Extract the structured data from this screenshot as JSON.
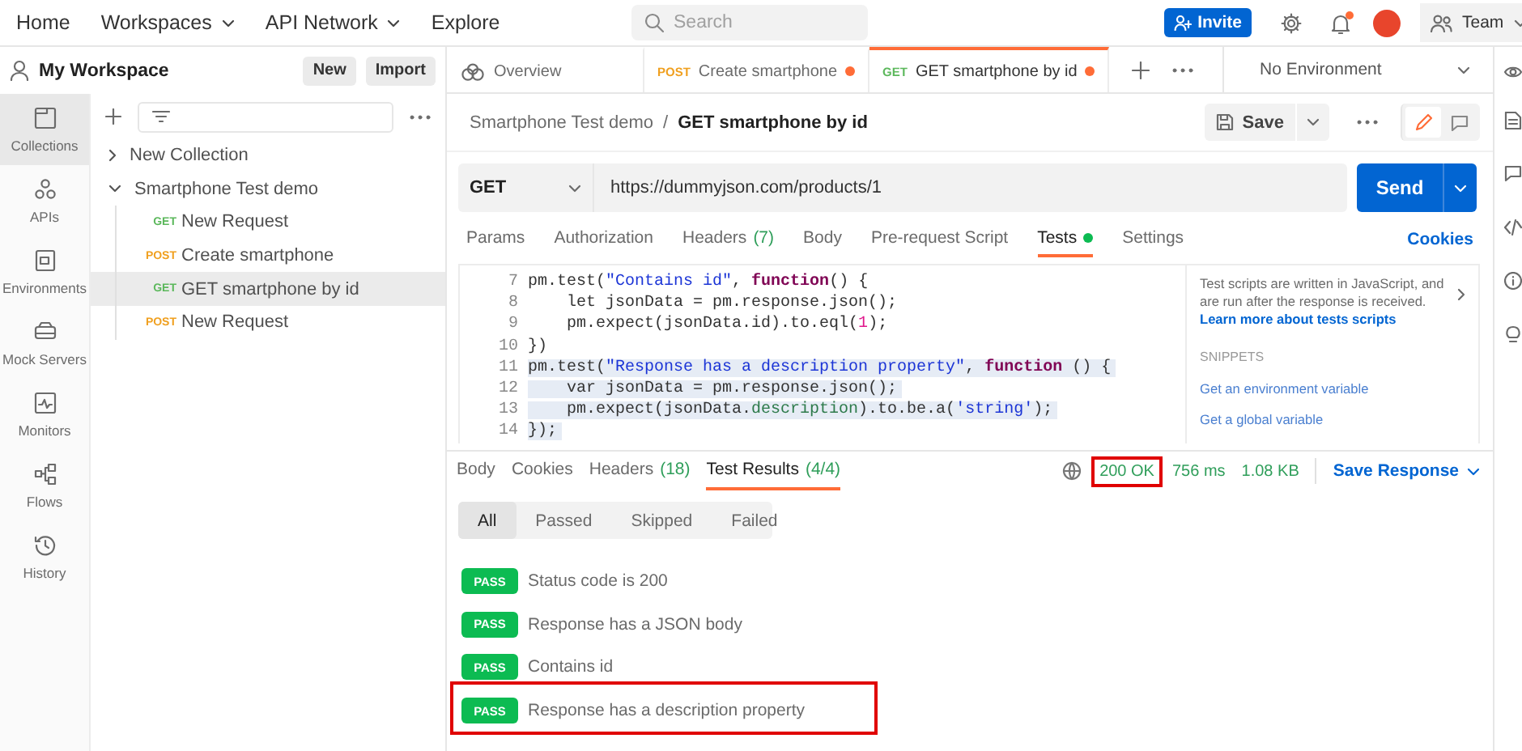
{
  "top_nav": {
    "items": [
      {
        "label": "Home",
        "dropdown": false
      },
      {
        "label": "Workspaces",
        "dropdown": true
      },
      {
        "label": "API Network",
        "dropdown": true
      },
      {
        "label": "Explore",
        "dropdown": false
      }
    ],
    "search": {
      "placeholder": "Search"
    },
    "invite_button": "Invite",
    "notification_dot": true,
    "team_button": "Team"
  },
  "workspace": {
    "title": "My Workspace",
    "buttons": [
      "New",
      "Import"
    ]
  },
  "sidebar_nav": [
    {
      "label": "Collections",
      "selected": true
    },
    {
      "label": "APIs",
      "selected": false
    },
    {
      "label": "Environments",
      "selected": false
    },
    {
      "label": "Mock Servers",
      "selected": false
    },
    {
      "label": "Monitors",
      "selected": false
    },
    {
      "label": "Flows",
      "selected": false
    },
    {
      "label": "History",
      "selected": false
    }
  ],
  "tree": [
    {
      "label": "New Collection",
      "expanded": false
    },
    {
      "label": "Smartphone Test demo",
      "expanded": true,
      "children": [
        {
          "method": "GET",
          "color": "#5cb85c",
          "label": "New Request",
          "selected": false
        },
        {
          "method": "POST",
          "color": "#f0a020",
          "label": "Create smartphone",
          "selected": false
        },
        {
          "method": "GET",
          "color": "#5cb85c",
          "label": "GET smartphone by id",
          "selected": true
        },
        {
          "method": "POST",
          "color": "#f0a020",
          "label": "New Request",
          "selected": false
        }
      ]
    }
  ],
  "tabs": [
    {
      "kind": "overview",
      "label": "Overview",
      "selected": false,
      "unsaved": false
    },
    {
      "kind": "request",
      "method": "POST",
      "color": "#f0a020",
      "label": "Create smartphone",
      "selected": false,
      "unsaved": true
    },
    {
      "kind": "request",
      "method": "GET",
      "color": "#5cb85c",
      "label": "GET smartphone by id",
      "selected": true,
      "unsaved": true
    }
  ],
  "environment": "No Environment",
  "breadcrumb": {
    "collection": "Smartphone Test demo",
    "separator": "/",
    "request": "GET smartphone by id"
  },
  "save_button": "Save",
  "request": {
    "method": "GET",
    "url": "https://dummyjson.com/products/1",
    "send_button": "Send"
  },
  "request_tabs": [
    {
      "label": "Params",
      "selected": false,
      "dot": false
    },
    {
      "label": "Authorization",
      "selected": false,
      "dot": false
    },
    {
      "label": "Headers",
      "count": "(7)",
      "selected": false,
      "dot": false
    },
    {
      "label": "Body",
      "selected": false,
      "dot": false
    },
    {
      "label": "Pre-request Script",
      "selected": false,
      "dot": false
    },
    {
      "label": "Tests",
      "selected": true,
      "dot": true
    },
    {
      "label": "Settings",
      "selected": false,
      "dot": false
    }
  ],
  "cookies_link": "Cookies",
  "editor": {
    "lines": [
      {
        "number": "7",
        "selected": false,
        "tokens": [
          {
            "kind": "plain",
            "text": "pm.test("
          },
          {
            "kind": "string",
            "text": "\"Contains id\""
          },
          {
            "kind": "plain",
            "text": ", "
          },
          {
            "kind": "keyword",
            "text": "function"
          },
          {
            "kind": "plain",
            "text": "() {"
          }
        ]
      },
      {
        "number": "8",
        "selected": false,
        "tokens": [
          {
            "kind": "plain",
            "text": "    let jsonData = pm.response.json();"
          }
        ]
      },
      {
        "number": "9",
        "selected": false,
        "tokens": [
          {
            "kind": "plain",
            "text": "    pm.expect(jsonData.id).to.eql("
          },
          {
            "kind": "number",
            "text": "1"
          },
          {
            "kind": "plain",
            "text": ");"
          }
        ]
      },
      {
        "number": "10",
        "selected": false,
        "tokens": [
          {
            "kind": "plain",
            "text": "})"
          }
        ]
      },
      {
        "number": "11",
        "selected": true,
        "tokens": [
          {
            "kind": "plain",
            "text": "pm.test("
          },
          {
            "kind": "string",
            "text": "\"Response has a description property\""
          },
          {
            "kind": "plain",
            "text": ", "
          },
          {
            "kind": "keyword",
            "text": "function"
          },
          {
            "kind": "plain",
            "text": " () {"
          }
        ]
      },
      {
        "number": "12",
        "selected": true,
        "tokens": [
          {
            "kind": "plain",
            "text": "    var jsonData = pm.response.json();"
          }
        ]
      },
      {
        "number": "13",
        "selected": true,
        "tokens": [
          {
            "kind": "plain",
            "text": "    pm.expect(jsonData."
          },
          {
            "kind": "property",
            "text": "description"
          },
          {
            "kind": "plain",
            "text": ").to.be.a("
          },
          {
            "kind": "string",
            "text": "'string'"
          },
          {
            "kind": "plain",
            "text": ");"
          }
        ]
      },
      {
        "number": "14",
        "selected": true,
        "tokens": [
          {
            "kind": "plain",
            "text": "});"
          }
        ]
      }
    ]
  },
  "help": {
    "text": "Test scripts are written in JavaScript, and are run after the response is received.",
    "link": "Learn more about tests scripts",
    "snippets_title": "SNIPPETS",
    "snippets": [
      "Get an environment variable",
      "Get a global variable"
    ]
  },
  "response_tabs": [
    {
      "label": "Body",
      "selected": false
    },
    {
      "label": "Cookies",
      "selected": false
    },
    {
      "label": "Headers",
      "count": "(18)",
      "selected": false
    },
    {
      "label": "Test Results",
      "count": "(4/4)",
      "selected": true
    }
  ],
  "response_status": {
    "status": "200 OK",
    "highlighted": true,
    "time": "756 ms",
    "size": "1.08 KB",
    "save_button": "Save Response"
  },
  "result_filters": [
    {
      "label": "All",
      "selected": true
    },
    {
      "label": "Passed",
      "selected": false
    },
    {
      "label": "Skipped",
      "selected": false
    },
    {
      "label": "Failed",
      "selected": false
    }
  ],
  "test_results": [
    {
      "status": "PASS",
      "name": "Status code is 200",
      "highlighted": false
    },
    {
      "status": "PASS",
      "name": "Response has a JSON body",
      "highlighted": false
    },
    {
      "status": "PASS",
      "name": "Contains id",
      "highlighted": false
    },
    {
      "status": "PASS",
      "name": "Response has a description property",
      "highlighted": true
    }
  ]
}
